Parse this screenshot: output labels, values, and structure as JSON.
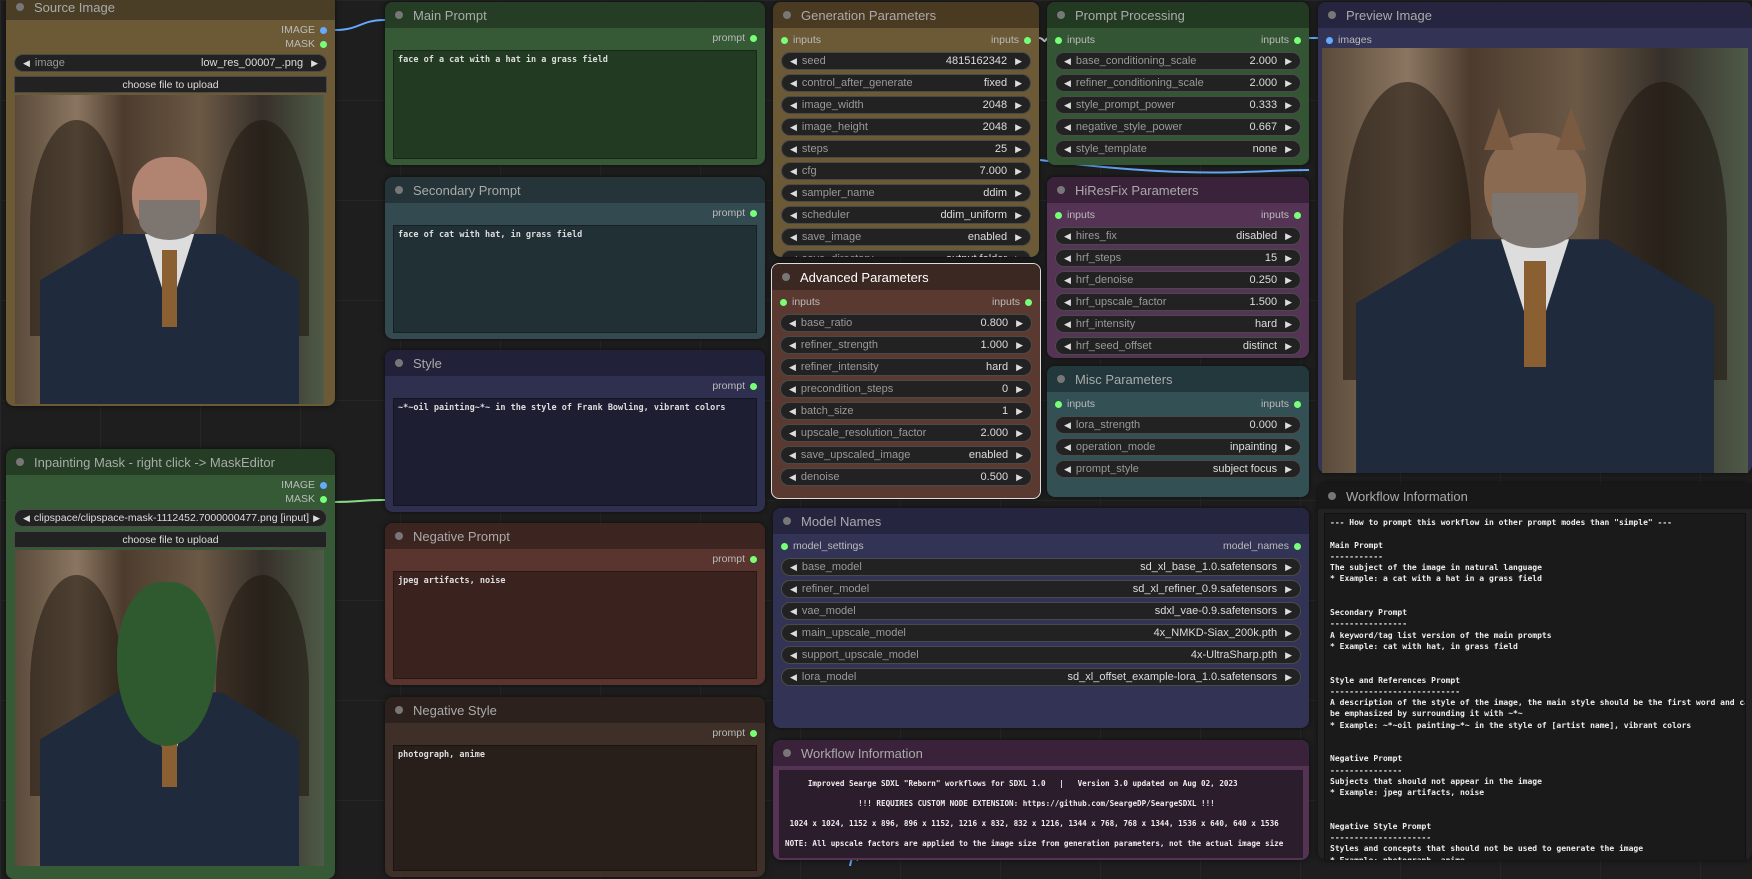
{
  "theme": {
    "slot_input": "#77ff77",
    "slot_image": "#66aaff"
  },
  "nodes": [
    {
      "id": "source",
      "title": "Source Image",
      "bg": "#6b5a35",
      "tb": "#4a3f26",
      "outputs": [
        {
          "label": "IMAGE",
          "type": "image"
        },
        {
          "label": "MASK",
          "type": "mask"
        }
      ],
      "widgets": [
        {
          "label": "image",
          "value": "low_res_00007_.png"
        }
      ],
      "button": "choose file to upload",
      "photo": "portrait"
    },
    {
      "id": "inpaint",
      "title": "Inpainting Mask - right click -> MaskEditor",
      "bg": "#355a35",
      "tb": "#243d24",
      "outputs": [
        {
          "label": "IMAGE",
          "type": "image"
        },
        {
          "label": "MASK",
          "type": "mask"
        }
      ],
      "widgets": [
        {
          "label": "",
          "value": "clipspace/clipspace-mask-1112452.7000000477.png [input]"
        }
      ],
      "button": "choose file to upload",
      "photo": "masked"
    },
    {
      "id": "main",
      "title": "Main Prompt",
      "bg": "#355a35",
      "tb": "#243d24",
      "outputs": [
        {
          "label": "prompt",
          "type": "mask"
        }
      ],
      "text": "face of a cat with a hat in a grass field"
    },
    {
      "id": "secondary",
      "title": "Secondary Prompt",
      "bg": "#334a50",
      "tb": "#243438",
      "outputs": [
        {
          "label": "prompt",
          "type": "mask"
        }
      ],
      "text": "face of cat with hat, in grass field"
    },
    {
      "id": "style",
      "title": "Style",
      "bg": "#2f2f4f",
      "tb": "#21213a",
      "outputs": [
        {
          "label": "prompt",
          "type": "mask"
        }
      ],
      "text": "~*~oil painting~*~ in the style of Frank Bowling, vibrant colors"
    },
    {
      "id": "negprompt",
      "title": "Negative Prompt",
      "bg": "#5a3530",
      "tb": "#3c2420",
      "outputs": [
        {
          "label": "prompt",
          "type": "mask"
        }
      ],
      "text": "jpeg artifacts, noise"
    },
    {
      "id": "negstyle",
      "title": "Negative Style",
      "bg": "#3e2f28",
      "tb": "#2c211c",
      "outputs": [
        {
          "label": "prompt",
          "type": "mask"
        }
      ],
      "text": "photograph, anime"
    },
    {
      "id": "gen",
      "title": "Generation Parameters",
      "bg": "#6b5a35",
      "tb": "#4a3a22",
      "input": "inputs",
      "output": "inputs",
      "widgets": [
        {
          "label": "seed",
          "value": "4815162342"
        },
        {
          "label": "control_after_generate",
          "value": "fixed"
        },
        {
          "label": "image_width",
          "value": "2048"
        },
        {
          "label": "image_height",
          "value": "2048"
        },
        {
          "label": "steps",
          "value": "25"
        },
        {
          "label": "cfg",
          "value": "7.000"
        },
        {
          "label": "sampler_name",
          "value": "ddim"
        },
        {
          "label": "scheduler",
          "value": "ddim_uniform"
        },
        {
          "label": "save_image",
          "value": "enabled"
        },
        {
          "label": "save_directory",
          "value": "output folder"
        }
      ]
    },
    {
      "id": "adv",
      "title": "Advanced Parameters",
      "bg": "#5a3a30",
      "tb": "#3c2822",
      "input": "inputs",
      "output": "inputs",
      "widgets": [
        {
          "label": "base_ratio",
          "value": "0.800"
        },
        {
          "label": "refiner_strength",
          "value": "1.000"
        },
        {
          "label": "refiner_intensity",
          "value": "hard"
        },
        {
          "label": "precondition_steps",
          "value": "0"
        },
        {
          "label": "batch_size",
          "value": "1"
        },
        {
          "label": "upscale_resolution_factor",
          "value": "2.000"
        },
        {
          "label": "save_upscaled_image",
          "value": "enabled"
        },
        {
          "label": "denoise",
          "value": "0.500"
        }
      ]
    },
    {
      "id": "models",
      "title": "Model Names",
      "bg": "#333355",
      "tb": "#252540",
      "input": "model_settings",
      "output": "model_names",
      "widgets": [
        {
          "label": "base_model",
          "value": "sd_xl_base_1.0.safetensors"
        },
        {
          "label": "refiner_model",
          "value": "sd_xl_refiner_0.9.safetensors"
        },
        {
          "label": "vae_model",
          "value": "sdxl_vae-0.9.safetensors"
        },
        {
          "label": "main_upscale_model",
          "value": "4x_NMKD-Siax_200k.pth"
        },
        {
          "label": "support_upscale_model",
          "value": "4x-UltraSharp.pth"
        },
        {
          "label": "lora_model",
          "value": "sd_xl_offset_example-lora_1.0.safetensors"
        }
      ]
    },
    {
      "id": "wfinfo2",
      "title": "Workflow Information",
      "bg": "#553355",
      "tb": "#3a223a",
      "info2": "     Improved Searge SDXL \"Reborn\" workflows for SDXL 1.0   |   Version 3.0 updated on Aug 02, 2023\n                !!! REQUIRES CUSTOM NODE EXTENSION: https://github.com/SeargeDP/SeargeSDXL !!!\n 1024 x 1024, 1152 x 896, 896 x 1152, 1216 x 832, 832 x 1216, 1344 x 768, 768 x 1344, 1536 x 640, 640 x 1536\nNOTE: All upscale factors are applied to the image size from generation parameters, not the actual image size"
    },
    {
      "id": "pp",
      "title": "Prompt Processing",
      "bg": "#335533",
      "tb": "#223a22",
      "input": "inputs",
      "output": "inputs",
      "widgets": [
        {
          "label": "base_conditioning_scale",
          "value": "2.000"
        },
        {
          "label": "refiner_conditioning_scale",
          "value": "2.000"
        },
        {
          "label": "style_prompt_power",
          "value": "0.333"
        },
        {
          "label": "negative_style_power",
          "value": "0.667"
        },
        {
          "label": "style_template",
          "value": "none"
        }
      ]
    },
    {
      "id": "hires",
      "title": "HiResFix Parameters",
      "bg": "#553355",
      "tb": "#3a223a",
      "input": "inputs",
      "output": "inputs",
      "widgets": [
        {
          "label": "hires_fix",
          "value": "disabled"
        },
        {
          "label": "hrf_steps",
          "value": "15"
        },
        {
          "label": "hrf_denoise",
          "value": "0.250"
        },
        {
          "label": "hrf_upscale_factor",
          "value": "1.500"
        },
        {
          "label": "hrf_intensity",
          "value": "hard"
        },
        {
          "label": "hrf_seed_offset",
          "value": "distinct"
        }
      ]
    },
    {
      "id": "misc",
      "title": "Misc Parameters",
      "bg": "#335055",
      "tb": "#22383c",
      "input": "inputs",
      "output": "inputs",
      "widgets": [
        {
          "label": "lora_strength",
          "value": "0.000"
        },
        {
          "label": "operation_mode",
          "value": "inpainting"
        },
        {
          "label": "prompt_style",
          "value": "subject focus"
        }
      ]
    },
    {
      "id": "preview",
      "title": "Preview Image",
      "bg": "#333355",
      "tb": "#252540",
      "input": "images",
      "input_type": "image",
      "photo": "cat"
    },
    {
      "id": "wfinfo",
      "title": "Workflow Information",
      "bg": "#222222",
      "tb": "#181818",
      "info": "--- How to prompt this workflow in other prompt modes than \"simple\" ---\n\nMain Prompt\n-----------\nThe subject of the image in natural language\n* Example: a cat with a hat in a grass field\n\n\nSecondary Prompt\n----------------\nA keyword/tag list version of the main prompts\n* Example: cat with hat, in grass field\n\n\nStyle and References Prompt\n---------------------------\nA description of the style of the image, the main style should be the first word and can\nbe emphasized by surrounding it with ~*~\n* Example: ~*~oil painting~*~ in the style of [artist name], vibrant colors\n\n\nNegative Prompt\n---------------\nSubjects that should not appear in the image\n* Example: jpeg artifacts, noise\n\n\nNegative Style Prompt\n---------------------\nStyles and concepts that should not be used to generate the image\n* Example: photograph, anime\n\n--- In \"simple\" prompt mode only the main prompt and negative prompt are used ---"
    }
  ]
}
